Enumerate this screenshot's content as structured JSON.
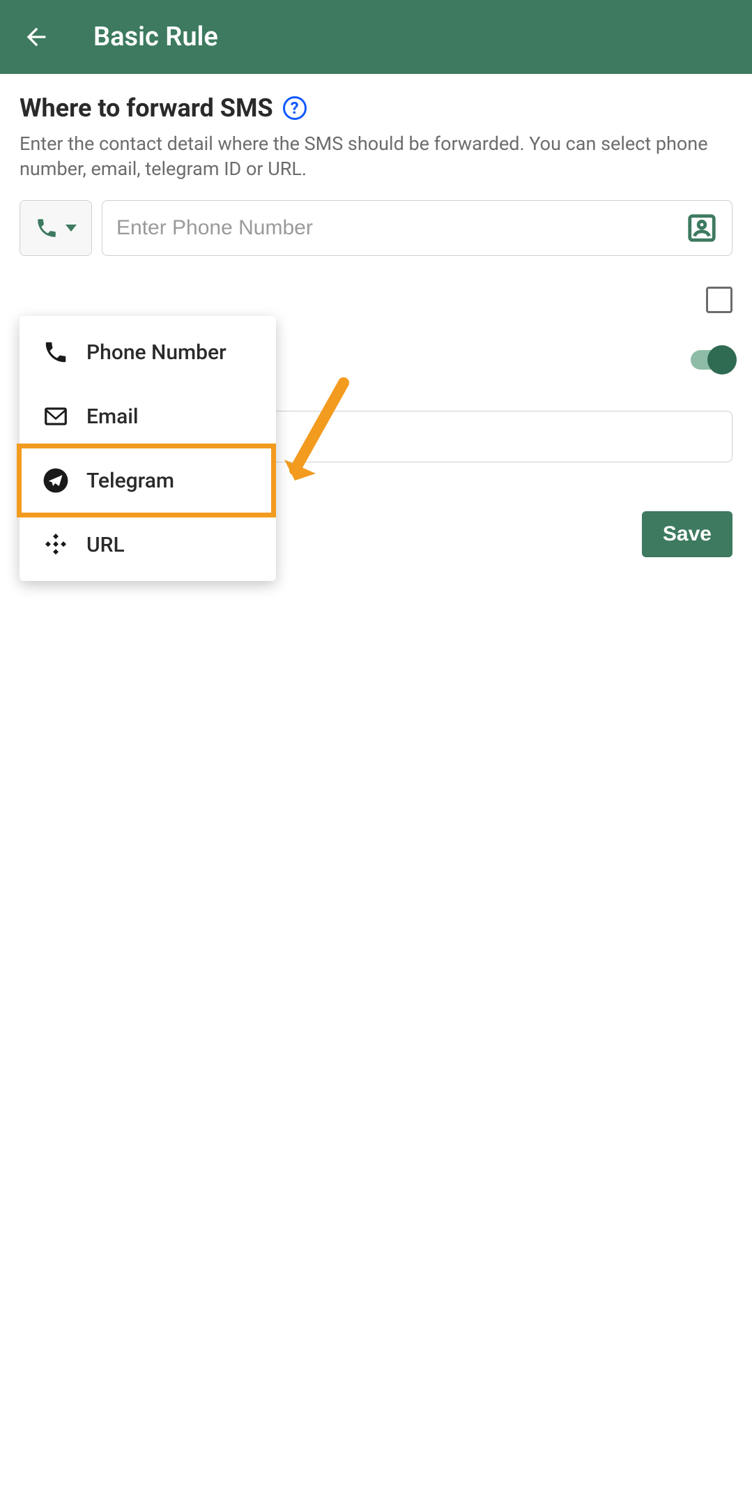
{
  "header": {
    "title": "Basic Rule"
  },
  "section": {
    "title": "Where to forward SMS",
    "description": "Enter the contact detail where the SMS should be forwarded. You can select phone number, email, telegram ID or URL."
  },
  "input": {
    "placeholder": "Enter Phone Number",
    "value": ""
  },
  "dropdown": {
    "options": [
      {
        "label": "Phone Number",
        "icon": "phone-icon"
      },
      {
        "label": "Email",
        "icon": "email-icon"
      },
      {
        "label": "Telegram",
        "icon": "telegram-icon",
        "highlighted": true
      },
      {
        "label": "URL",
        "icon": "url-icon"
      }
    ]
  },
  "actions": {
    "save_label": "Save"
  },
  "colors": {
    "primary": "#3d7a5f",
    "highlight": "#f29b1f",
    "help": "#1259ff"
  }
}
